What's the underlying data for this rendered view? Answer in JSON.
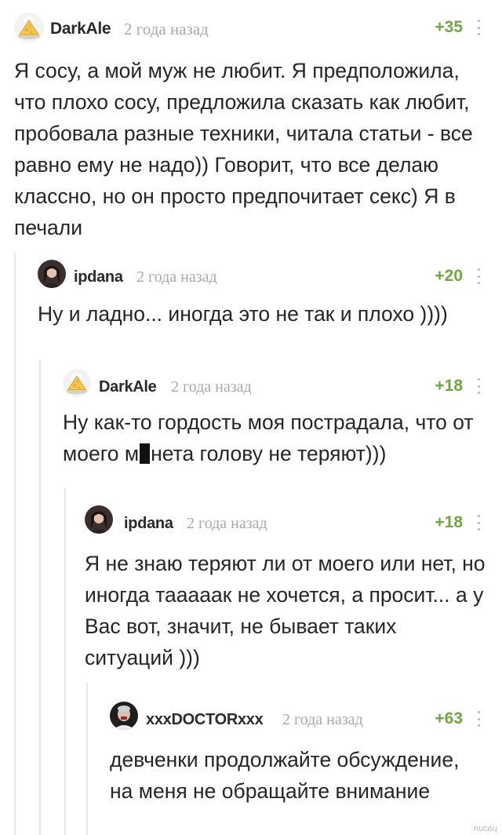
{
  "colors": {
    "score": "#6fa843",
    "time": "#a9a9a9",
    "text": "#262626"
  },
  "comments": [
    {
      "author": "DarkAle",
      "time": "2 года назад",
      "score": "+35",
      "text": "Я сосу, а мой муж не любит. Я предположила, что плохо сосу, предложила сказать как любит, пробовала разные техники, читала статьи - все равно ему не надо)) Говорит, что все делаю классно, но он просто предпочитает секс) Я в печали"
    },
    {
      "author": "ipdana",
      "time": "2 года назад",
      "score": "+20",
      "text": "Ну и ладно... иногда это не так и плохо ))))"
    },
    {
      "author": "DarkAle",
      "time": "2 года назад",
      "score": "+18",
      "text_before": "Ну как-то гордость моя пострадала, что от моего м",
      "text_after": "нета голову не теряют)))"
    },
    {
      "author": "ipdana",
      "time": "2 года назад",
      "score": "+18",
      "text": "Я не знаю теряют ли от моего или нет, но иногда тааааак не хочется, а просит... а у Вас вот, значит, не бывает таких ситуаций )))"
    },
    {
      "author": "xxxDOCTORxxx",
      "time": "2 года назад",
      "score": "+63",
      "text": "девченки продолжайте обсуждение, на меня не обращайте внимание"
    }
  ],
  "watermark": "писец"
}
